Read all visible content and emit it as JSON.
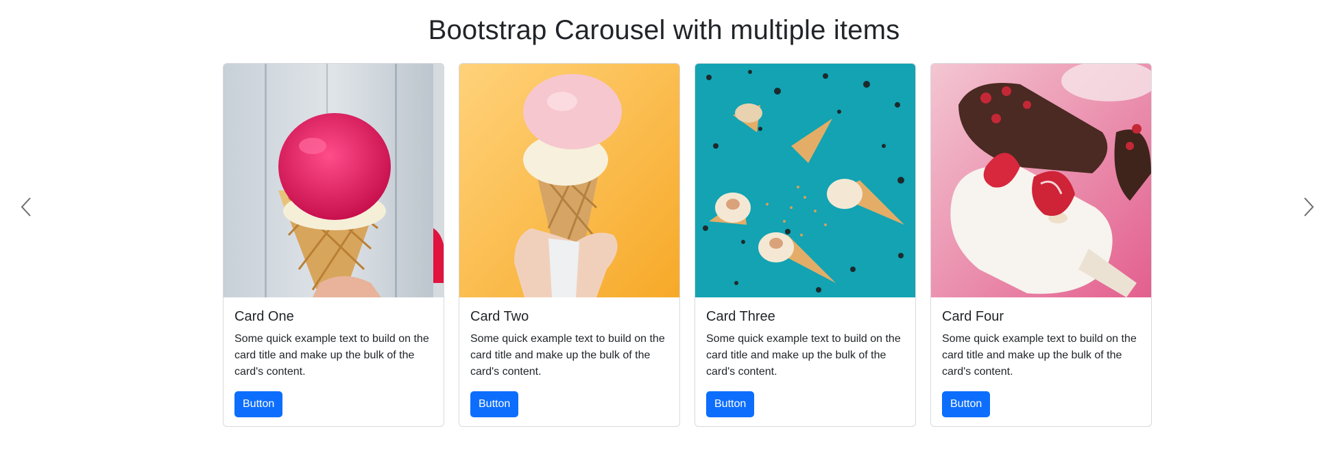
{
  "page": {
    "title": "Bootstrap Carousel with multiple items"
  },
  "carousel": {
    "prev_icon": "chevron-left-icon",
    "next_icon": "chevron-right-icon",
    "cards": [
      {
        "title": "Card One",
        "text": "Some quick example text to build on the card title and make up the bulk of the card's content.",
        "button_label": "Button",
        "image": "pink-ice-cream-cone-image"
      },
      {
        "title": "Card Two",
        "text": "Some quick example text to build on the card title and make up the bulk of the card's content.",
        "button_label": "Button",
        "image": "hand-holding-ice-cream-cone-image"
      },
      {
        "title": "Card Three",
        "text": "Some quick example text to build on the card title and make up the bulk of the card's content.",
        "button_label": "Button",
        "image": "ice-cream-cones-on-teal-image"
      },
      {
        "title": "Card Four",
        "text": "Some quick example text to build on the card title and make up the bulk of the card's content.",
        "button_label": "Button",
        "image": "strawberry-popsicle-image"
      }
    ]
  },
  "colors": {
    "button": "#0d6efd",
    "button_text": "#ffffff",
    "card_border": "#d7d9dc",
    "text": "#212529"
  }
}
